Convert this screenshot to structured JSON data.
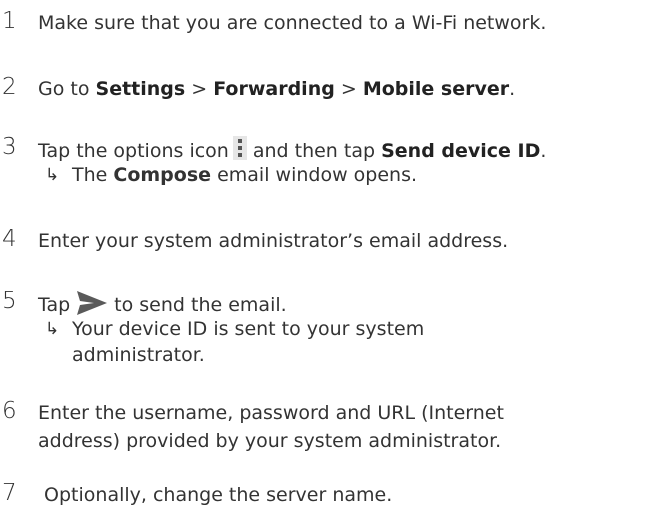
{
  "steps": [
    {
      "number": "1",
      "text": "Make sure that you are connected to a Wi-Fi network."
    },
    {
      "number": "2",
      "prefix": "Go to ",
      "path": [
        "Settings",
        "Forwarding",
        "Mobile server"
      ],
      "separator": " > ",
      "suffix": "."
    },
    {
      "number": "3",
      "before_icon": "Tap the options icon",
      "icon": "options-vertical-dots-icon",
      "after_icon": "and then tap ",
      "action": "Send device ID",
      "end": ".",
      "result": {
        "arrow": "↳",
        "before": "The ",
        "bold": "Compose",
        "after": " email window opens."
      }
    },
    {
      "number": "4",
      "text": "Enter your system administrator’s email address."
    },
    {
      "number": "5",
      "before_icon": "Tap",
      "icon": "send-arrow-icon",
      "after_icon": "to send the email.",
      "result": {
        "arrow": "↳",
        "line1": "Your device ID is sent to your system",
        "line2": "administrator."
      }
    },
    {
      "number": "6",
      "line1": "Enter the username, password and URL (Internet",
      "line2": "address) provided by your system administrator."
    },
    {
      "number": "7",
      "text": " Optionally, change the server name."
    }
  ],
  "colors": {
    "text": "#333333",
    "send_icon": "#5a5a5a",
    "options_icon_bg": "#e6e6e6"
  }
}
